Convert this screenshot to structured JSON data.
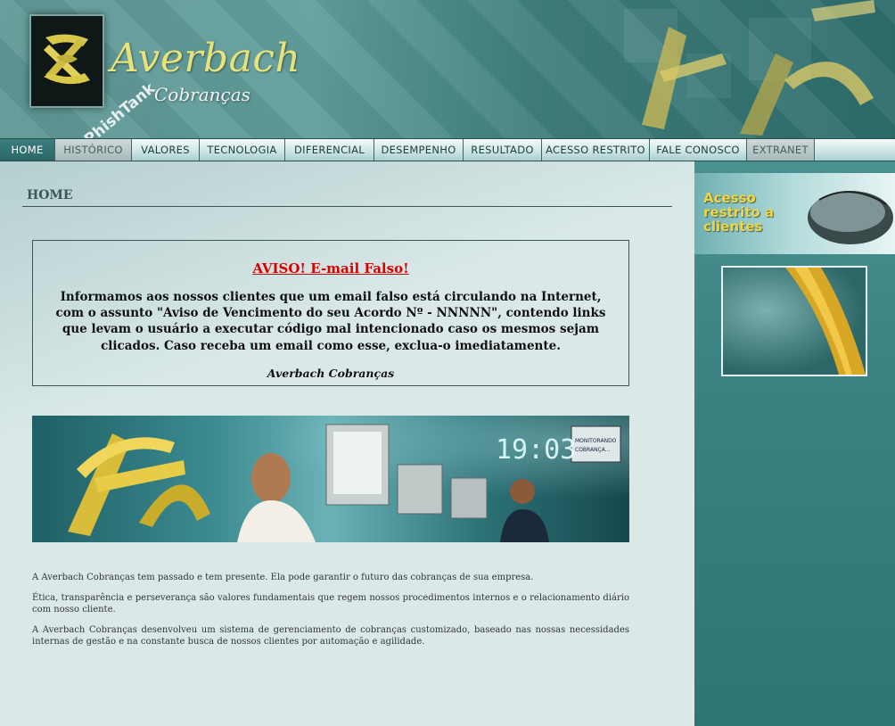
{
  "header": {
    "brand_name": "Averbach",
    "brand_sub": "Cobranças",
    "watermark": "PhishTank"
  },
  "nav": {
    "items": [
      {
        "label": "HOME"
      },
      {
        "label": "HISTÓRICO"
      },
      {
        "label": "VALORES"
      },
      {
        "label": "TECNOLOGIA"
      },
      {
        "label": "DIFERENCIAL"
      },
      {
        "label": "DESEMPENHO"
      },
      {
        "label": "RESULTADO"
      },
      {
        "label": "ACESSO RESTRITO"
      },
      {
        "label": "FALE CONOSCO"
      },
      {
        "label": "EXTRANET"
      }
    ]
  },
  "main": {
    "page_title": "HOME",
    "notice": {
      "title": "AVISO! E-mail Falso!",
      "body": "Informamos aos nossos clientes que um email falso está circulando na Internet, com o assunto \"Aviso de Vencimento do seu Acordo Nº - NNNNN\", contendo links que levam o usuário a executar código mal intencionado caso os mesmos sejam clicados. Caso receba um email como esse, exclua-o imediatamente.",
      "signature": "Averbach Cobranças"
    },
    "banner": {
      "clock": "19:03",
      "screen_text_1": "MONITORANDO",
      "screen_text_2": "COBRANÇA..."
    },
    "intro": [
      "A Averbach Cobranças tem passado e tem presente. Ela pode garantir o futuro das cobranças de sua empresa.",
      "Ética, transparência e perseverança são valores fundamentais que regem nossos procedimentos internos e o relacionamento diário com nosso cliente.",
      "A Averbach Cobranças desenvolveu um sistema de gerenciamento de cobranças customizado, baseado nas nossas necessidades internas de gestão e na constante busca de nossos clientes por automação e agilidade."
    ]
  },
  "sidebar": {
    "access_banner_text": "Acesso\nrestrito a\nclientes"
  },
  "colors": {
    "accent_gold": "#e8e27a",
    "alert_red": "#d80000",
    "nav_active": "#2a6667",
    "sidebar_teal": "#3a8181"
  }
}
